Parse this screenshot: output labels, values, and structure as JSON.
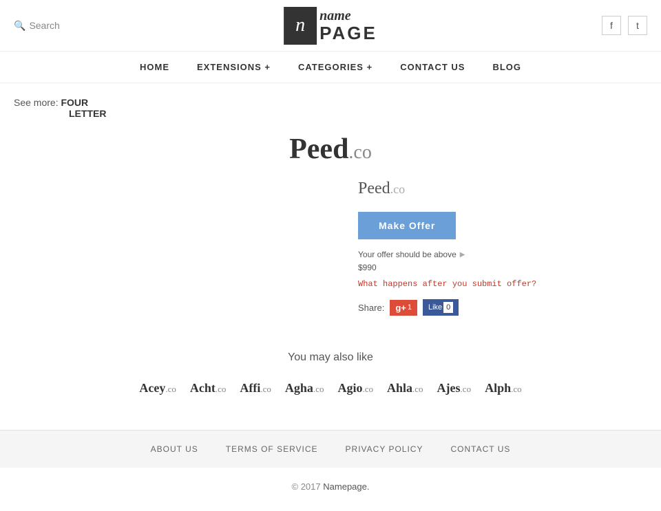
{
  "header": {
    "search_label": "Search",
    "logo_icon": "n",
    "logo_name": "name",
    "logo_page": "PAGE",
    "facebook_icon": "f",
    "twitter_icon": "t"
  },
  "nav": {
    "items": [
      {
        "label": "HOME",
        "has_plus": false
      },
      {
        "label": "EXTENSIONS +",
        "has_plus": false
      },
      {
        "label": "CATEGORIES +",
        "has_plus": false
      },
      {
        "label": "CONTACT US",
        "has_plus": false
      },
      {
        "label": "BLOG",
        "has_plus": false
      }
    ]
  },
  "see_more": {
    "label": "See more:",
    "link1": "FOUR",
    "link2": "LETTER"
  },
  "domain": {
    "name": "Peed",
    "ext": ".co",
    "full": "Peed.co",
    "make_offer_label": "Make Offer",
    "offer_info": "Your offer should be above",
    "offer_amount": "$990",
    "offer_link_text": "What happens after you submit offer?",
    "share_label": "Share:",
    "gplus_label": "g+1",
    "fb_like_label": "Like",
    "fb_count": "0"
  },
  "also_like": {
    "title": "You may also like",
    "domains": [
      {
        "name": "Acey",
        "ext": ".co"
      },
      {
        "name": "Acht",
        "ext": ".co"
      },
      {
        "name": "Affi",
        "ext": ".co"
      },
      {
        "name": "Agha",
        "ext": ".co"
      },
      {
        "name": "Agio",
        "ext": ".co"
      },
      {
        "name": "Ahla",
        "ext": ".co"
      },
      {
        "name": "Ajes",
        "ext": ".co"
      },
      {
        "name": "Alph",
        "ext": ".co"
      }
    ]
  },
  "footer": {
    "nav_items": [
      {
        "label": "ABOUT US"
      },
      {
        "label": "TERMS OF SERVICE"
      },
      {
        "label": "PRIVACY POLICY"
      },
      {
        "label": "CONTACT US"
      }
    ],
    "copyright": "© 2017",
    "brand": "Namepage."
  }
}
